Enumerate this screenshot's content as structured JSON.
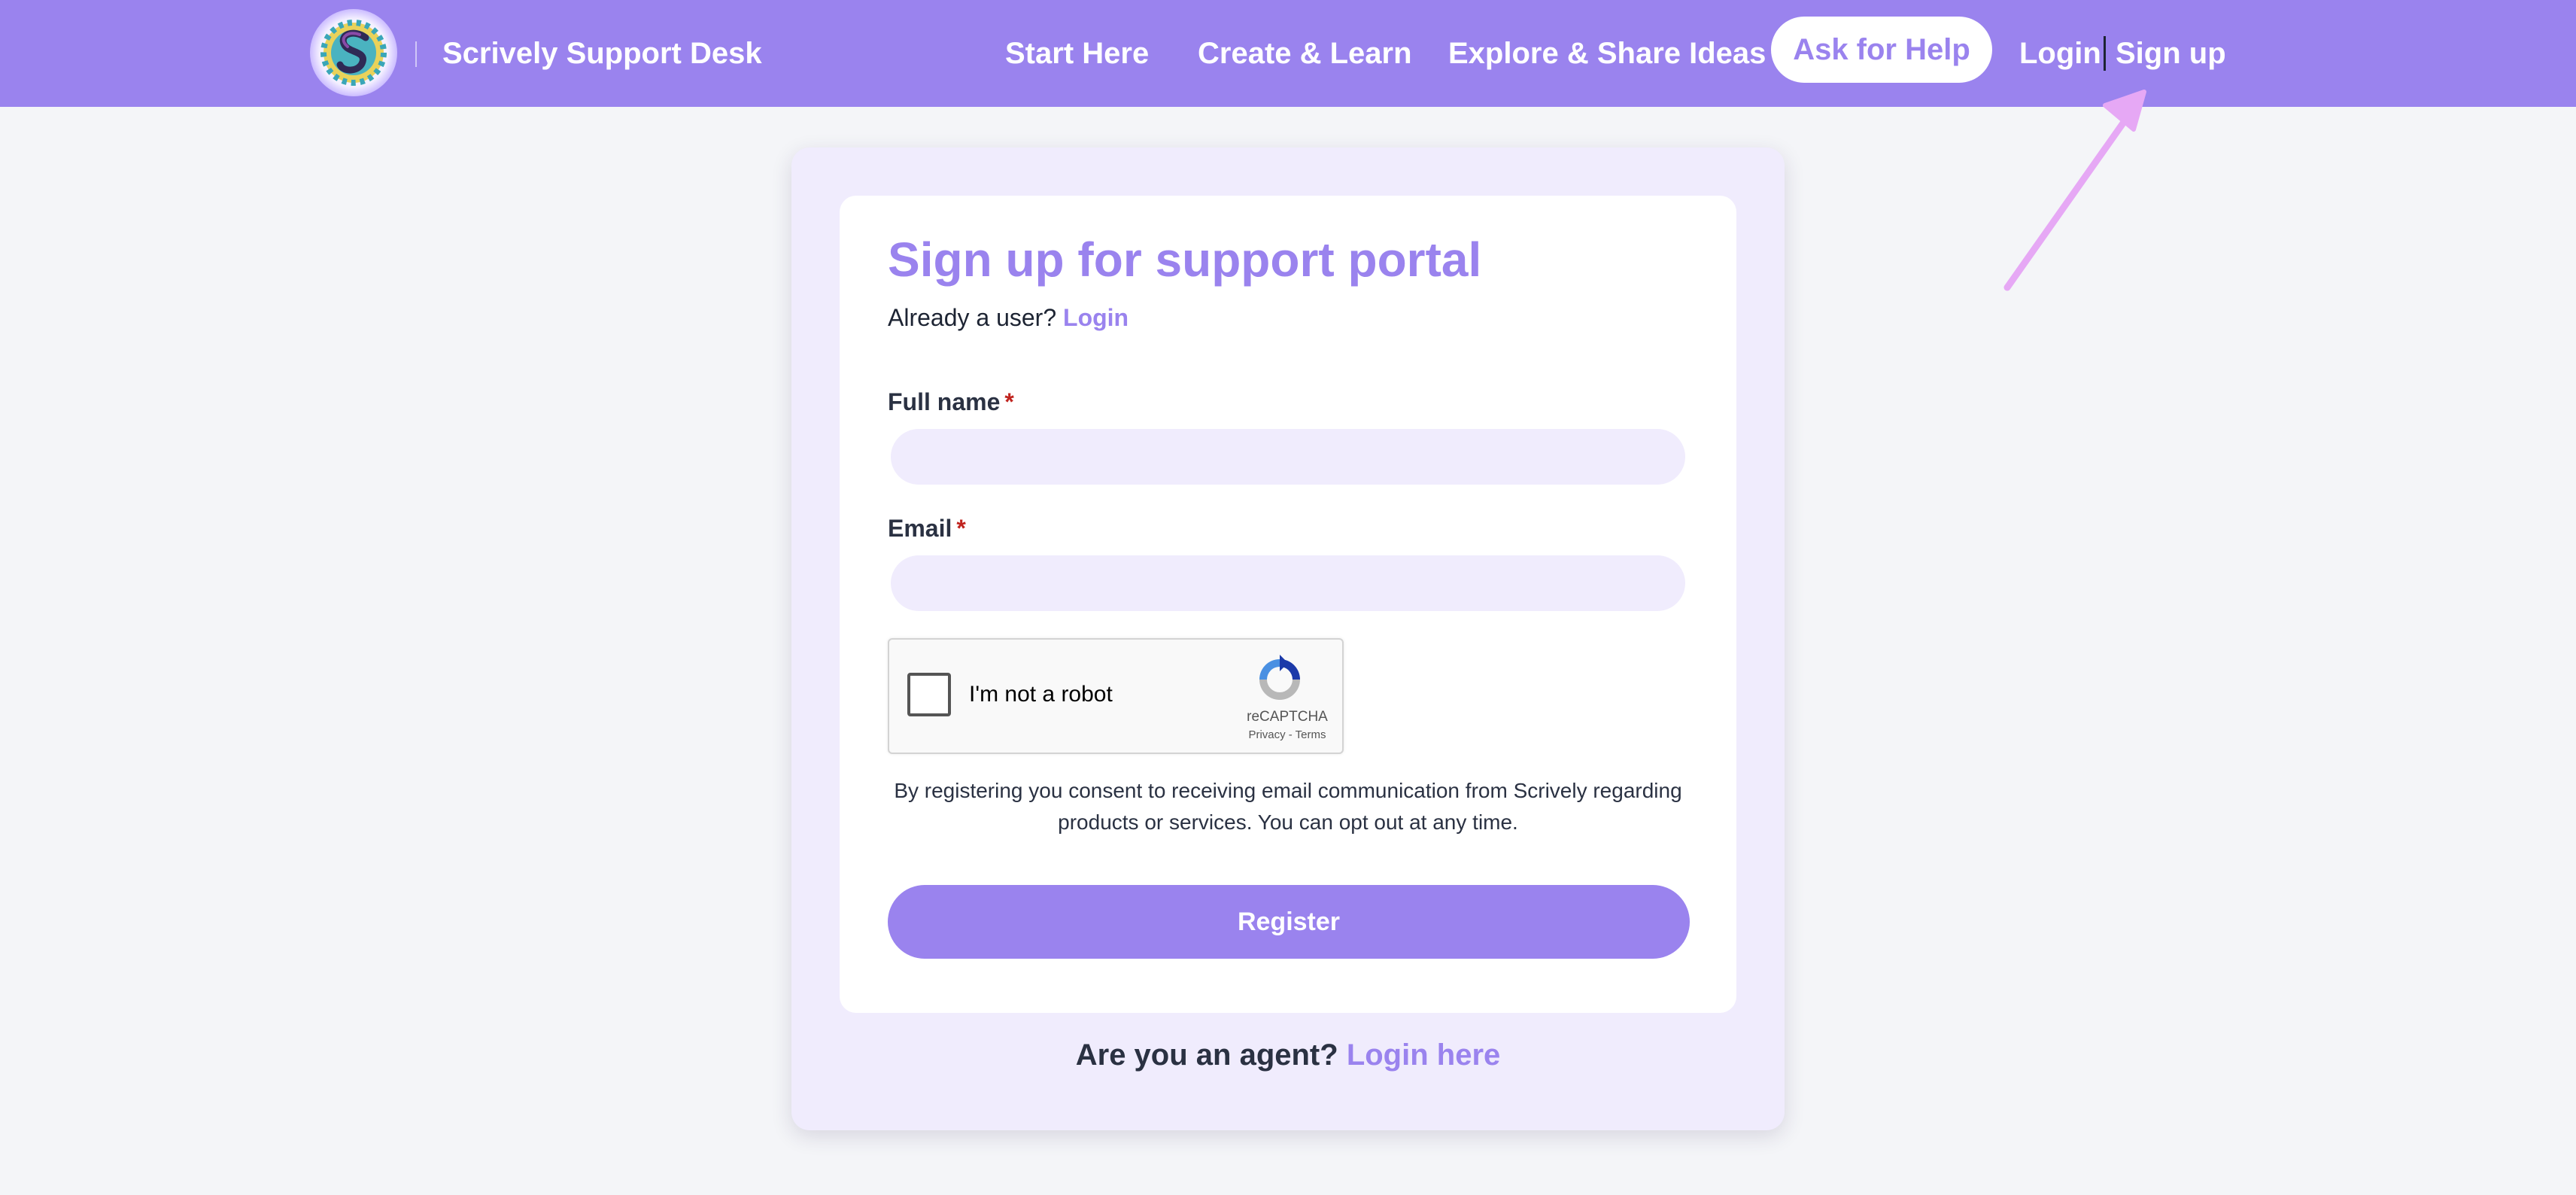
{
  "header": {
    "brand_title": "Scrively Support Desk",
    "logo_icon": "scrively-logo-icon",
    "nav": {
      "start_here": "Start Here",
      "create_learn": "Create & Learn",
      "explore_share": "Explore & Share Ideas"
    },
    "help_button": "Ask for Help",
    "login": "Login",
    "signup": "Sign up"
  },
  "form": {
    "title": "Sign up for support portal",
    "already_text": "Already a user?",
    "already_link": "Login",
    "full_name_label": "Full name",
    "email_label": "Email",
    "required_mark": "*",
    "full_name_value": "",
    "email_value": ""
  },
  "recaptcha": {
    "label": "I'm not a robot",
    "brand": "reCAPTCHA",
    "links": "Privacy - Terms",
    "checked": false
  },
  "consent_text": "By registering you consent to receiving email communication from Scrively regarding products or services. You can opt out at any time.",
  "register_button": "Register",
  "agent": {
    "text": "Are you an agent?",
    "link": "Login here"
  },
  "colors": {
    "accent": "#9a83ee",
    "card_bg": "#f0ecfd",
    "page_bg": "#f4f5f8",
    "annotation_arrow": "#e6a8f5",
    "required": "#c0241f"
  }
}
